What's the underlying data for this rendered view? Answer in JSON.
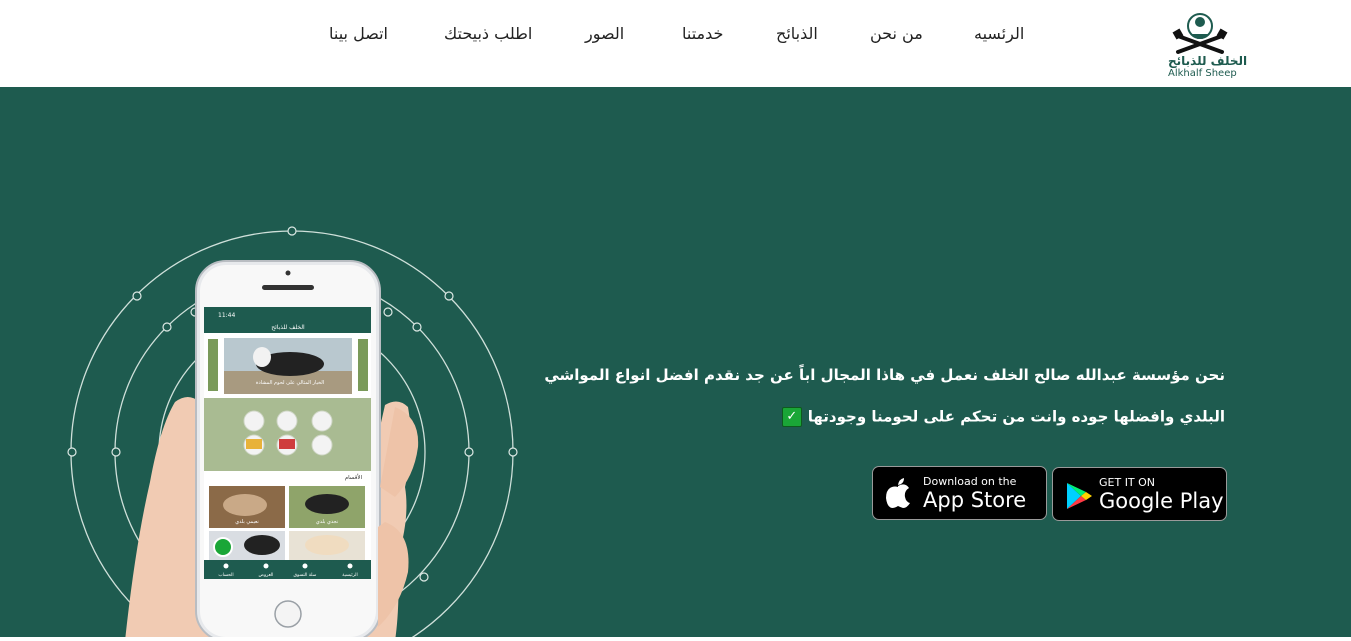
{
  "nav": {
    "items": [
      {
        "label": "الرئسيه"
      },
      {
        "label": "من نحن"
      },
      {
        "label": "الذبائح"
      },
      {
        "label": "خدمتنا"
      },
      {
        "label": "الصور"
      },
      {
        "label": "اطلب ذبيحتك"
      },
      {
        "label": "اتصل بينا"
      }
    ]
  },
  "logo": {
    "text_ar": "الخلف للذبائح",
    "text_en": "Alkhalf Sheep"
  },
  "hero": {
    "line1": "نحن مؤسسة عبدالله صالح الخلف نعمل في هاذا المجال اباً عن جد نقدم افضل انواع المواشي",
    "line2": "البلدي وافضلها جوده وانت من تحكم على لحومنا وجودتها",
    "check_icon": "✓"
  },
  "stores": {
    "app_store": {
      "small": "Download on the",
      "big": "App Store"
    },
    "google_play": {
      "small": "GET IT ON",
      "big": "Google Play"
    }
  },
  "phone": {
    "status_time": "11:44",
    "app_title": "الخلف للذبائح",
    "banner_caption": "الخيار المثالي على لحوم المشادة",
    "section_title": "الأقسام",
    "categories": [
      "نعيمي بلدي",
      "نجدي بلدي"
    ],
    "bottom_nav": [
      "الرئيسية",
      "سلة التسوق",
      "العروض",
      "الحساب"
    ]
  },
  "colors": {
    "primary": "#1e5b4f",
    "check": "#1aa637"
  }
}
